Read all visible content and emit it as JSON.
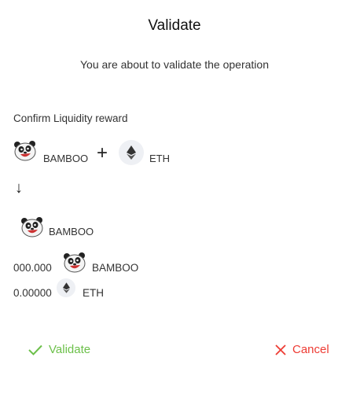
{
  "dialog": {
    "title": "Validate",
    "subtitle": "You are about to validate the operation",
    "operation_label": "Confirm Liquidity reward",
    "inputs": [
      {
        "token": "BAMBOO",
        "icon": "panda-icon"
      },
      {
        "token": "ETH",
        "icon": "eth-icon"
      }
    ],
    "plus": "+",
    "arrow": "↓",
    "output": {
      "token": "BAMBOO",
      "icon": "panda-icon"
    },
    "amounts": [
      {
        "value": "000.000",
        "token": "BAMBOO",
        "icon": "panda-icon"
      },
      {
        "value": "0.00000",
        "token": "ETH",
        "icon": "eth-icon"
      }
    ],
    "validate_label": "Validate",
    "cancel_label": "Cancel",
    "colors": {
      "validate": "#6cc04a",
      "cancel": "#ee3b33"
    }
  }
}
